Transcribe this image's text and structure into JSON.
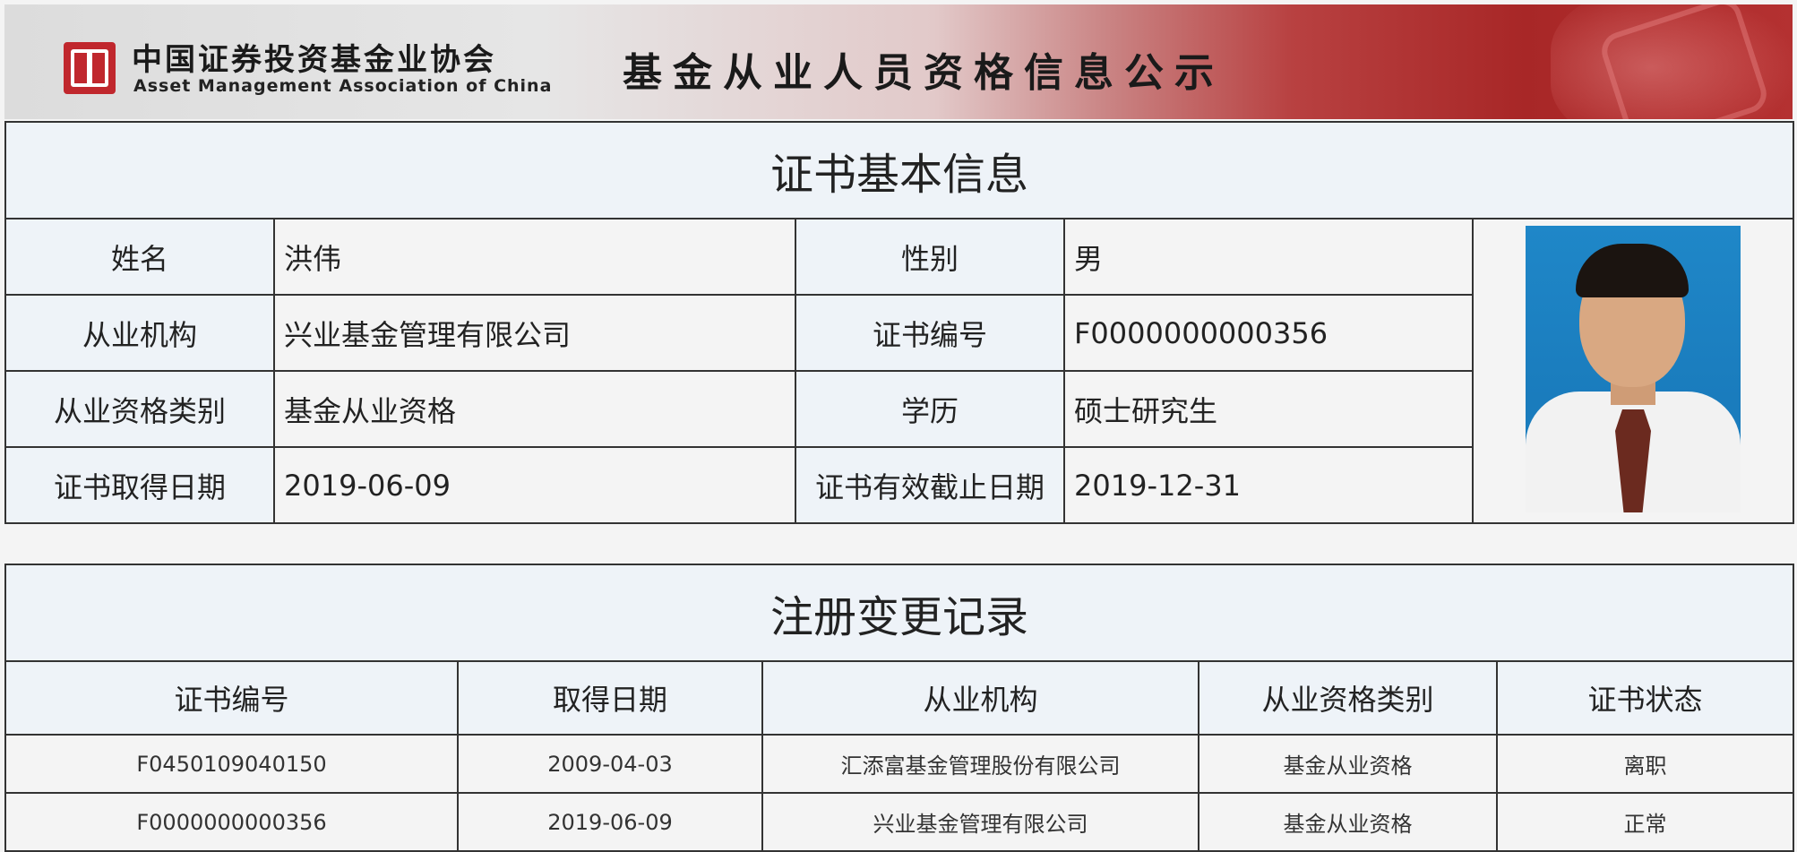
{
  "banner": {
    "org_name_cn": "中国证券投资基金业协会",
    "org_name_en": "Asset Management Association of China",
    "page_title": "基金从业人员资格信息公示"
  },
  "basic_info": {
    "title": "证书基本信息",
    "labels": {
      "name": "姓名",
      "gender": "性别",
      "institution": "从业机构",
      "cert_no": "证书编号",
      "qualification": "从业资格类别",
      "education": "学历",
      "obtain_date": "证书取得日期",
      "expiry_date": "证书有效截止日期"
    },
    "values": {
      "name": "洪伟",
      "gender": "男",
      "institution": "兴业基金管理有限公司",
      "cert_no": "F0000000000356",
      "qualification": "基金从业资格",
      "education": "硕士研究生",
      "obtain_date": "2019-06-09",
      "expiry_date": "2019-12-31"
    }
  },
  "change_records": {
    "title": "注册变更记录",
    "headers": [
      "证书编号",
      "取得日期",
      "从业机构",
      "从业资格类别",
      "证书状态"
    ],
    "rows": [
      [
        "F0450109040150",
        "2009-04-03",
        "汇添富基金管理股份有限公司",
        "基金从业资格",
        "离职"
      ],
      [
        "F0000000000356",
        "2019-06-09",
        "兴业基金管理有限公司",
        "基金从业资格",
        "正常"
      ]
    ]
  },
  "colors": {
    "header_bg": "#eef3f8",
    "cell_bg": "#f4f4f4",
    "banner_red": "#a82727",
    "border": "#333333"
  }
}
